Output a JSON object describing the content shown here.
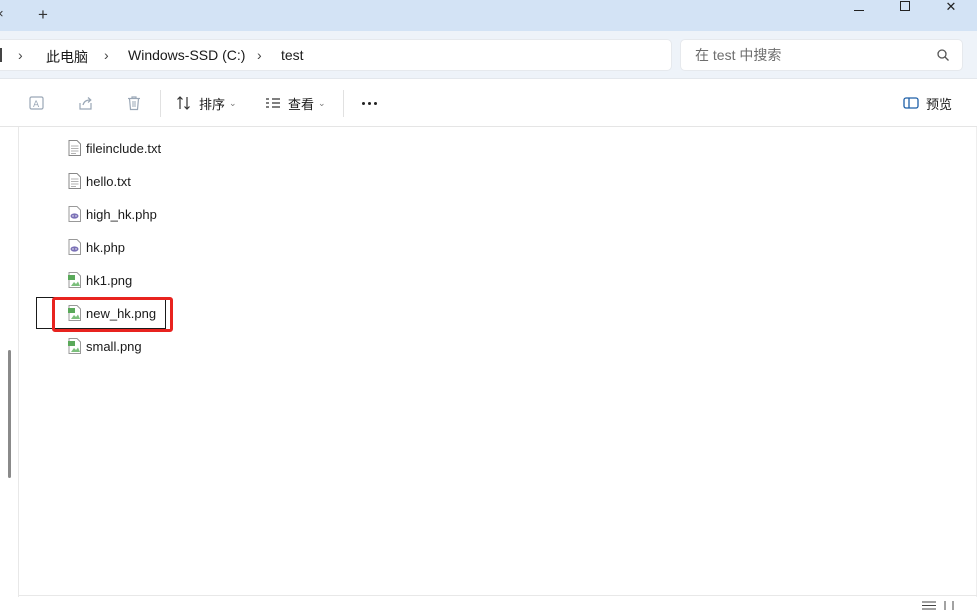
{
  "titlebar": {
    "tab_close_glyph": "×",
    "new_tab_glyph": "+",
    "close_glyph": "✕"
  },
  "address": {
    "breadcrumbs": [
      "此电脑",
      "Windows-SSD (C:)",
      "test"
    ],
    "separator": "›"
  },
  "search": {
    "placeholder": "在 test 中搜索"
  },
  "toolbar": {
    "sort_label": "排序",
    "view_label": "查看",
    "preview_label": "预览"
  },
  "files": [
    {
      "name": "fileinclude.txt",
      "icon": "text-file-icon"
    },
    {
      "name": "hello.txt",
      "icon": "text-file-icon"
    },
    {
      "name": "high_hk.php",
      "icon": "php-file-icon"
    },
    {
      "name": "hk.php",
      "icon": "php-file-icon"
    },
    {
      "name": "hk1.png",
      "icon": "image-file-icon"
    },
    {
      "name": "new_hk.png",
      "icon": "image-file-icon"
    },
    {
      "name": "small.png",
      "icon": "image-file-icon"
    }
  ],
  "colors": {
    "highlight": "#e8231f",
    "titlebar": "#d3e3f5",
    "address_row": "#eef3f9"
  }
}
